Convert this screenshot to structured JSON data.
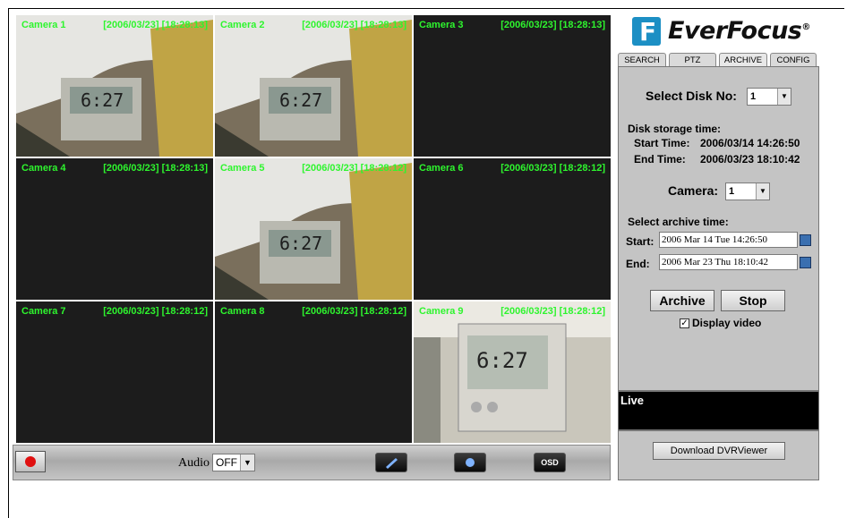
{
  "cameras": [
    {
      "label": "Camera 1",
      "timestamp": "[2006/03/23] [18:28:13]"
    },
    {
      "label": "Camera 2",
      "timestamp": "[2006/03/23] [18:28:13]"
    },
    {
      "label": "Camera 3",
      "timestamp": "[2006/03/23] [18:28:13]"
    },
    {
      "label": "Camera 4",
      "timestamp": "[2006/03/23] [18:28:13]"
    },
    {
      "label": "Camera 5",
      "timestamp": "[2006/03/23] [18:28:12]"
    },
    {
      "label": "Camera 6",
      "timestamp": "[2006/03/23] [18:28:12]"
    },
    {
      "label": "Camera 7",
      "timestamp": "[2006/03/23] [18:28:12]"
    },
    {
      "label": "Camera 8",
      "timestamp": "[2006/03/23] [18:28:12]"
    },
    {
      "label": "Camera 9",
      "timestamp": "[2006/03/23] [18:28:12]"
    }
  ],
  "bottom_bar": {
    "audio_label": "Audio",
    "audio_value": "OFF",
    "osd_label": "OSD"
  },
  "brand": {
    "logo_letter": "F",
    "name": "EverFocus",
    "registered": "®",
    "color": "#1c8fc4"
  },
  "tabs": [
    "SEARCH",
    "PTZ",
    "ARCHIVE",
    "CONFIG"
  ],
  "archive": {
    "select_disk_label": "Select Disk No:",
    "disk_value": "1",
    "storage_time_label": "Disk storage time:",
    "start_time_label": "Start Time:",
    "start_time_value": "2006/03/14 14:26:50",
    "end_time_label": "End Time:",
    "end_time_value": "2006/03/23 18:10:42",
    "camera_label": "Camera:",
    "camera_value": "1",
    "select_archive_label": "Select archive time:",
    "start_label": "Start:",
    "start_input": "2006 Mar 14 Tue  14:26:50",
    "end_label": "End:",
    "end_input": "2006 Mar 23 Thu  18:10:42",
    "archive_button": "Archive",
    "stop_button": "Stop",
    "display_video_label": "Display video",
    "display_video_checked": true
  },
  "status": {
    "text": "Live"
  },
  "download_button": "Download DVRViewer"
}
